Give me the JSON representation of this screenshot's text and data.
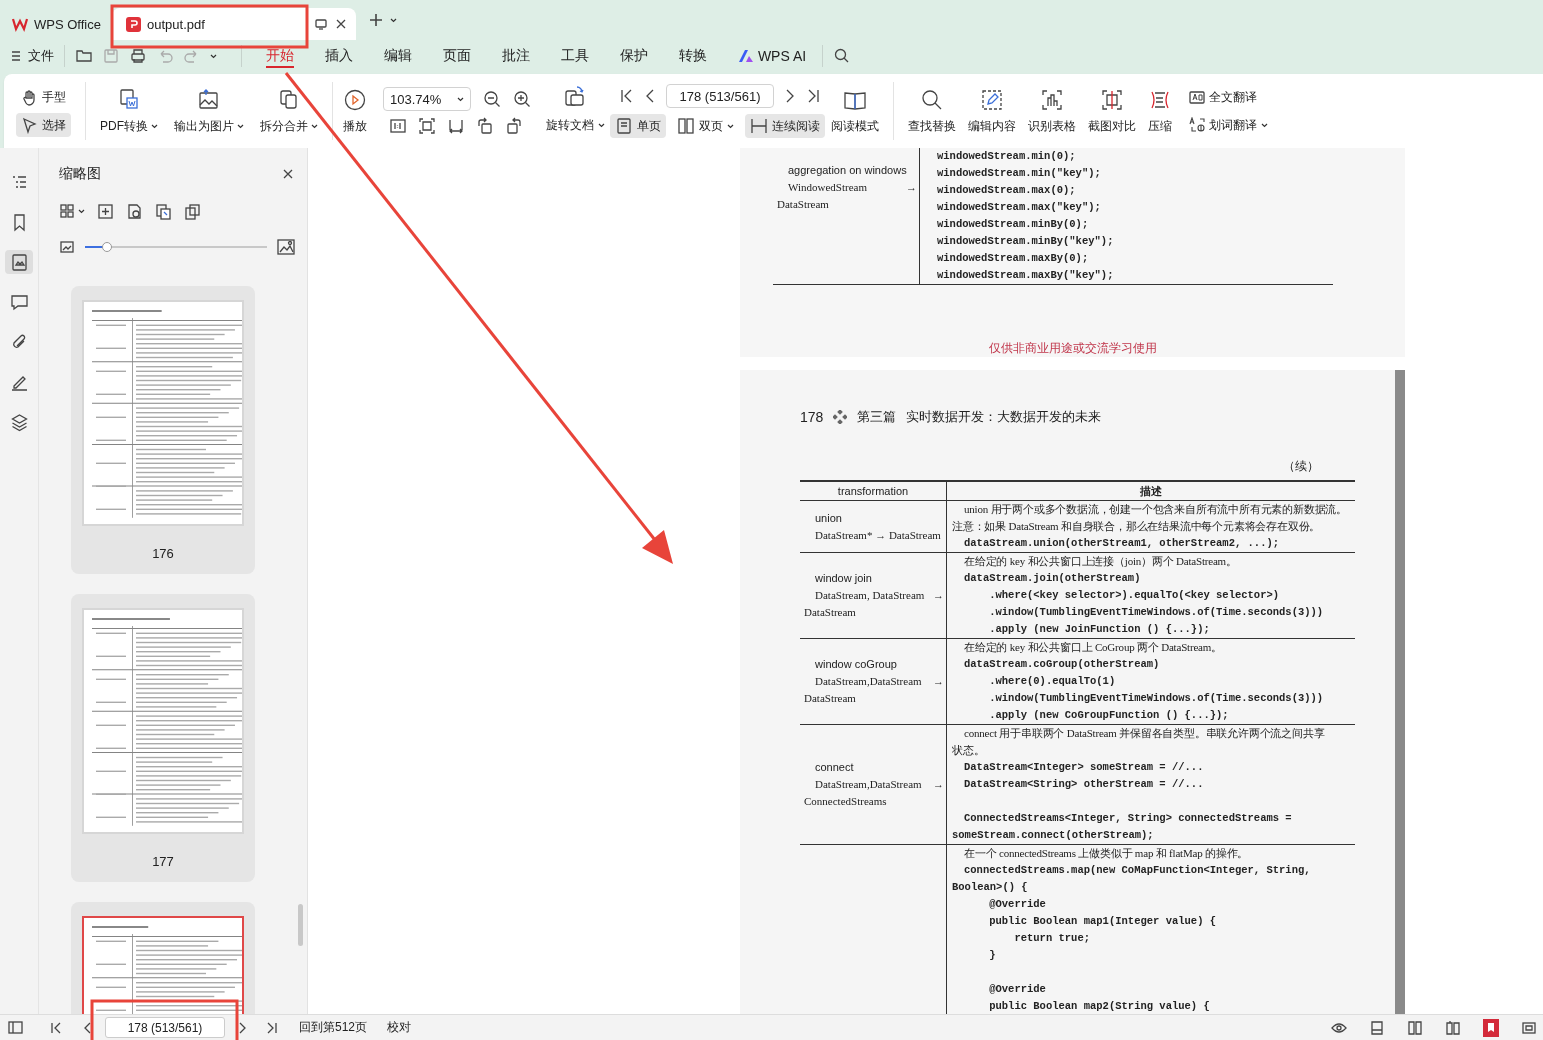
{
  "tabs": [
    {
      "kind": "home",
      "label": "WPS Office",
      "selected": false
    },
    {
      "kind": "doc",
      "label": "output.pdf",
      "selected": true
    }
  ],
  "menu": {
    "file": "文件",
    "items": [
      {
        "label": "开始",
        "selected": true
      },
      {
        "label": "插入",
        "selected": false
      },
      {
        "label": "编辑",
        "selected": false
      },
      {
        "label": "页面",
        "selected": false
      },
      {
        "label": "批注",
        "selected": false
      },
      {
        "label": "工具",
        "selected": false
      },
      {
        "label": "保护",
        "selected": false
      },
      {
        "label": "转换",
        "selected": false
      },
      {
        "label": "WPS AI",
        "selected": false
      }
    ]
  },
  "ribbon": {
    "modes": [
      {
        "label": "手型",
        "selected": false
      },
      {
        "label": "选择",
        "selected": true
      }
    ],
    "converters": [
      {
        "kind": "pdf",
        "label": "PDF转换",
        "dropdown": true
      },
      {
        "kind": "image",
        "label": "输出为图片",
        "dropdown": true
      },
      {
        "kind": "split",
        "label": "拆分合并",
        "dropdown": true
      }
    ],
    "play": "播放",
    "zoom": "103.74%",
    "page": "178 (513/561)",
    "rotate": {
      "label": "旋转文档",
      "dropdown": true
    },
    "views": [
      {
        "kind": "single",
        "label": "单页",
        "selected": true,
        "dropdown": false
      },
      {
        "kind": "double",
        "label": "双页",
        "selected": false,
        "dropdown": true
      },
      {
        "kind": "continuous",
        "label": "连续阅读",
        "selected": true,
        "dropdown": false
      }
    ],
    "reading_mode": "阅读模式",
    "tools": [
      {
        "kind": "search",
        "label": "查找替换"
      },
      {
        "kind": "edit",
        "label": "编辑内容"
      },
      {
        "kind": "table",
        "label": "识别表格"
      },
      {
        "kind": "compare",
        "label": "截图对比"
      },
      {
        "kind": "compress",
        "label": "压缩"
      }
    ],
    "translate": [
      {
        "kind": "full",
        "label": "全文翻译",
        "dropdown": false
      },
      {
        "kind": "word",
        "label": "划词翻译",
        "dropdown": true
      }
    ]
  },
  "sidebar": {
    "title": "缩略图",
    "size_slider": {
      "level": 0.12
    },
    "thumbnails": [
      {
        "label": "176",
        "selected": false
      },
      {
        "label": "177",
        "selected": false
      },
      {
        "selected": true
      }
    ]
  },
  "document": {
    "previous_page": {
      "rows": [
        {
          "name": "aggregation on windows",
          "signature": "WindowedStream",
          "arrow": "→",
          "result": "DataStream",
          "lines": [
            {
              "kind": "code",
              "text": "windowedStream.min(0);"
            },
            {
              "kind": "code",
              "text": "windowedStream.min(\"key\");"
            },
            {
              "kind": "code",
              "text": "windowedStream.max(0);"
            },
            {
              "kind": "code",
              "text": "windowedStream.max(\"key\");"
            },
            {
              "kind": "code",
              "text": "windowedStream.minBy(0);"
            },
            {
              "kind": "code",
              "text": "windowedStream.minBy(\"key\");"
            },
            {
              "kind": "code",
              "text": "windowedStream.maxBy(0);"
            },
            {
              "kind": "code",
              "text": "windowedStream.maxBy(\"key\");"
            }
          ]
        }
      ],
      "footer": "仅供非商业用途或交流学习使用"
    },
    "page": {
      "number": "178",
      "part": "第三篇",
      "title": "实时数据开发：大数据开发的未来",
      "continued": "（续）",
      "columns": [
        "transformation",
        "描述"
      ],
      "rows": [
        {
          "name": "union",
          "signature": "DataStream* → DataStream",
          "lines": [
            {
              "kind": "prose",
              "text": "union 用于两个或多个数据流，创建一个包含来自所有流中所有元素的新数据流。"
            },
            {
              "kind": "prose-wrap",
              "text": "注意：如果 DataStream 和自身联合，那么在结果流中每个元素将会存在双份。"
            },
            {
              "kind": "code",
              "text": "dataStream.union(otherStream1, otherStream2, ...);"
            }
          ]
        },
        {
          "name": "window join",
          "signature": "DataStream, DataStream",
          "arrow": "→",
          "result": "DataStream",
          "lines": [
            {
              "kind": "prose",
              "text": "在给定的 key 和公共窗口上连接（join）两个 DataStream。"
            },
            {
              "kind": "code",
              "text": "dataStream.join(otherStream)"
            },
            {
              "kind": "code",
              "text": "    .where(<key selector>).equalTo(<key selector>)"
            },
            {
              "kind": "code",
              "text": "    .window(TumblingEventTimeWindows.of(Time.seconds(3)))"
            },
            {
              "kind": "code",
              "text": "    .apply (new JoinFunction () {...});"
            }
          ]
        },
        {
          "name": "window coGroup",
          "signature": "DataStream,DataStream",
          "arrow": "→",
          "result": "DataStream",
          "lines": [
            {
              "kind": "prose",
              "text": "在给定的 key 和公共窗口上 CoGroup 两个 DataStream。"
            },
            {
              "kind": "code",
              "text": "dataStream.coGroup(otherStream)"
            },
            {
              "kind": "code",
              "text": "    .where(0).equalTo(1)"
            },
            {
              "kind": "code",
              "text": "    .window(TumblingEventTimeWindows.of(Time.seconds(3)))"
            },
            {
              "kind": "code",
              "text": "    .apply (new CoGroupFunction () {...});"
            }
          ]
        },
        {
          "name": "connect",
          "signature": "DataStream,DataStream",
          "arrow": "→",
          "result": "ConnectedStreams",
          "lines": [
            {
              "kind": "prose",
              "text": "connect 用于串联两个 DataStream 并保留各自类型。串联允许两个流之间共享"
            },
            {
              "kind": "prose-wrap",
              "text": "状态。"
            },
            {
              "kind": "code",
              "text": "DataStream<Integer> someStream = //..."
            },
            {
              "kind": "code",
              "text": "DataStream<String> otherStream = //..."
            },
            {
              "kind": "blank"
            },
            {
              "kind": "code",
              "text": "ConnectedStreams<Integer, String> connectedStreams ="
            },
            {
              "kind": "code-wrap",
              "text": "someStream.connect(otherStream);"
            }
          ]
        },
        {
          "lines": [
            {
              "kind": "prose",
              "text": "在一个 connectedStreams 上做类似于 map 和 flatMap 的操作。"
            },
            {
              "kind": "code",
              "text": "connectedStreams.map(new CoMapFunction<Integer, String,"
            },
            {
              "kind": "code-wrap",
              "text": "Boolean>() {"
            },
            {
              "kind": "code",
              "text": "    @Override"
            },
            {
              "kind": "code",
              "text": "    public Boolean map1(Integer value) {"
            },
            {
              "kind": "code",
              "text": "        return true;"
            },
            {
              "kind": "code",
              "text": "    }"
            },
            {
              "kind": "blank"
            },
            {
              "kind": "code",
              "text": "    @Override"
            },
            {
              "kind": "code",
              "text": "    public Boolean map2(String value) {"
            }
          ]
        }
      ]
    }
  },
  "status_bar": {
    "page": "178 (513/561)",
    "back": "回到第512页",
    "proofread": "校对"
  },
  "annotations": [
    {
      "kind": "frame"
    },
    {
      "kind": "frame"
    },
    {
      "kind": "arrow"
    }
  ]
}
